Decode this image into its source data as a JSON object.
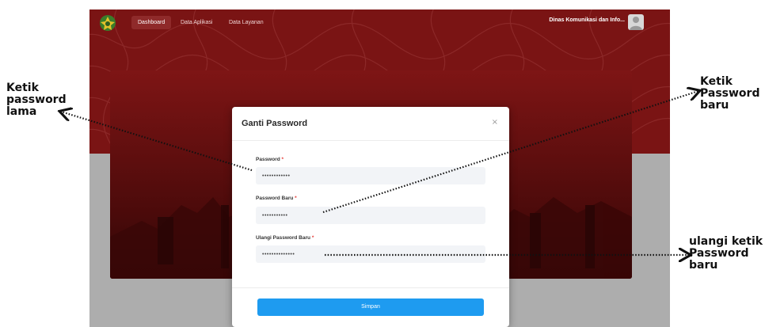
{
  "navbar": {
    "links": [
      "Dashboard",
      "Data Aplikasi",
      "Data Layanan"
    ],
    "active_index": 0,
    "user_name": "Dinas Komunikasi dan Info..."
  },
  "modal": {
    "title": "Ganti Password",
    "close_symbol": "×",
    "fields": [
      {
        "label": "Password",
        "required_mark": "*",
        "value": "••••••••••••"
      },
      {
        "label": "Password Baru",
        "required_mark": "*",
        "value": "•••••••••••"
      },
      {
        "label": "Ulangi Password Baru",
        "required_mark": "*",
        "value": "••••••••••••••"
      }
    ],
    "save_label": "Simpan"
  },
  "annotations": {
    "old_password": [
      "Ketik",
      "password",
      "lama"
    ],
    "new_password": [
      "Ketik",
      "Password",
      "baru"
    ],
    "repeat_password": [
      "ulangi ketik",
      "Password",
      "baru"
    ]
  },
  "colors": {
    "hero": "#7a1414",
    "primary_button": "#1e9bf0",
    "required": "#e53935"
  }
}
